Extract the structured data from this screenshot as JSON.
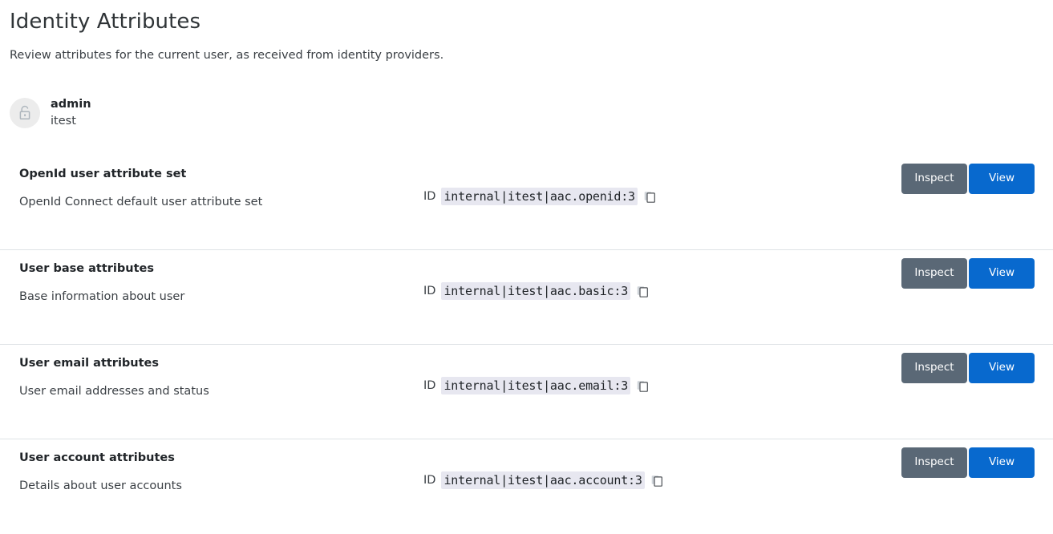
{
  "header": {
    "title": "Identity Attributes",
    "subtitle": "Review attributes for the current user, as received from identity providers."
  },
  "user": {
    "avatar_icon": "lock-icon",
    "name": "admin",
    "realm": "itest"
  },
  "labels": {
    "id_label": "ID",
    "copy_icon": "copy-icon",
    "inspect_label": "Inspect",
    "view_label": "View"
  },
  "colors": {
    "inspect_button": "#5a6876",
    "view_button": "#0869ce",
    "code_background": "#e7e7f0",
    "divider": "#dfe3e6",
    "avatar_background": "#ececec"
  },
  "attribute_sets": [
    {
      "title": "OpenId user attribute set",
      "description": "OpenId Connect default user attribute set",
      "id": "internal|itest|aac.openid:3"
    },
    {
      "title": "User base attributes",
      "description": "Base information about user",
      "id": "internal|itest|aac.basic:3"
    },
    {
      "title": "User email attributes",
      "description": "User email addresses and status",
      "id": "internal|itest|aac.email:3"
    },
    {
      "title": "User account attributes",
      "description": "Details about user accounts",
      "id": "internal|itest|aac.account:3"
    }
  ]
}
